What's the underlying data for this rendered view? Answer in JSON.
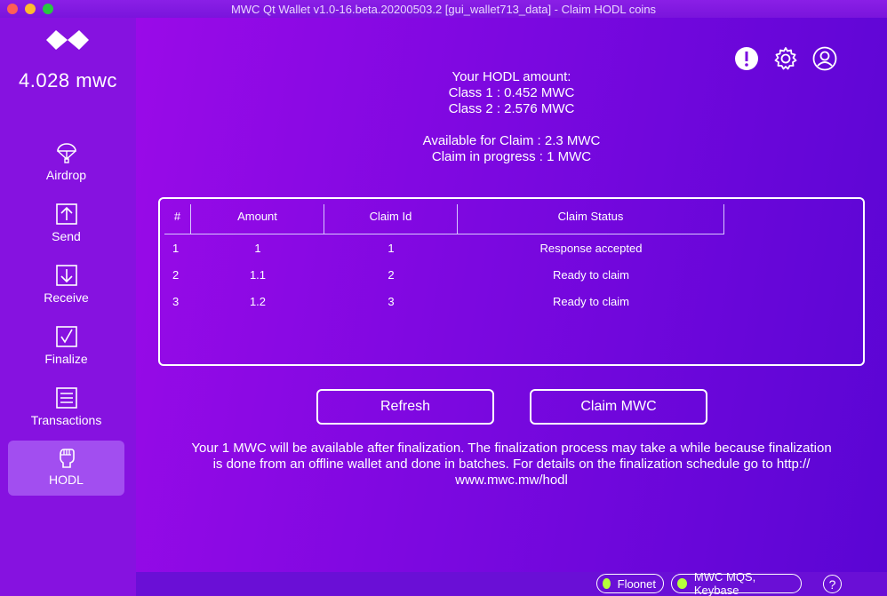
{
  "window": {
    "title": "MWC Qt Wallet v1.0-16.beta.20200503.2 [gui_wallet713_data] - Claim HODL coins"
  },
  "sidebar": {
    "balance": "4.028 mwc",
    "items": [
      {
        "label": "Airdrop",
        "icon": "parachute-icon"
      },
      {
        "label": "Send",
        "icon": "send-arrow-icon"
      },
      {
        "label": "Receive",
        "icon": "receive-arrow-icon"
      },
      {
        "label": "Finalize",
        "icon": "checkbox-icon"
      },
      {
        "label": "Transactions",
        "icon": "list-icon"
      },
      {
        "label": "HODL",
        "icon": "fist-icon",
        "active": true
      }
    ]
  },
  "header_icons": [
    "alert-icon",
    "gear-icon",
    "account-icon"
  ],
  "summary": {
    "hodl_title": "Your HODL amount:",
    "class1": "Class 1 : 0.452 MWC",
    "class2": "Class 2 : 2.576 MWC",
    "available": "Available for Claim : 2.3 MWC",
    "in_progress": "Claim in progress : 1 MWC"
  },
  "table": {
    "headers": {
      "num": "#",
      "amount": "Amount",
      "claim_id": "Claim Id",
      "status": "Claim Status"
    },
    "rows": [
      {
        "num": "1",
        "amount": "1",
        "claim_id": "1",
        "status": "Response accepted"
      },
      {
        "num": "2",
        "amount": "1.1",
        "claim_id": "2",
        "status": "Ready to claim"
      },
      {
        "num": "3",
        "amount": "1.2",
        "claim_id": "3",
        "status": "Ready to claim"
      }
    ]
  },
  "buttons": {
    "refresh": "Refresh",
    "claim": "Claim MWC"
  },
  "note": {
    "line1": "Your 1 MWC will be available after finalization. The finalization process may take a while because finalization",
    "line2": "is done from an offline wallet and done in batches. For details on the finalization schedule go to http://",
    "line3": "www.mwc.mw/hodl"
  },
  "status": {
    "network": "Floonet",
    "connection": "MWC MQS, Keybase",
    "indicator_color": "#b6ff3b",
    "help": "?"
  },
  "colors": {
    "sidebar_bg": "#8612e0",
    "active_item_bg": "#a24ef0",
    "main_gradient_start": "#9a0ae8",
    "main_gradient_end": "#5a05d4"
  }
}
